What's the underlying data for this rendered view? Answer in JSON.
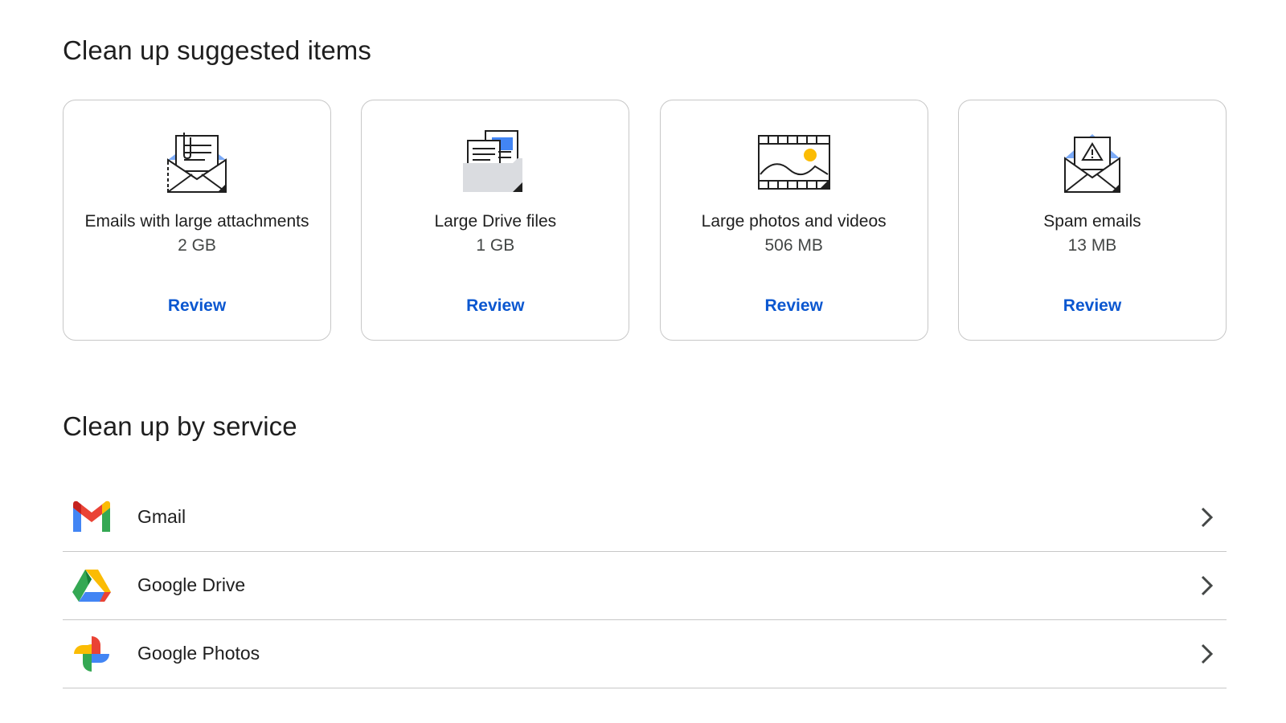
{
  "suggested": {
    "title": "Clean up suggested items",
    "cards": [
      {
        "icon": "email-attachment-icon",
        "label": "Emails with large attachments",
        "size": "2 GB",
        "action": "Review"
      },
      {
        "icon": "drive-files-icon",
        "label": "Large Drive files",
        "size": "1 GB",
        "action": "Review"
      },
      {
        "icon": "photos-videos-icon",
        "label": "Large photos and videos",
        "size": "506 MB",
        "action": "Review"
      },
      {
        "icon": "spam-email-icon",
        "label": "Spam emails",
        "size": "13 MB",
        "action": "Review"
      }
    ]
  },
  "by_service": {
    "title": "Clean up by service",
    "items": [
      {
        "icon": "gmail-logo-icon",
        "label": "Gmail"
      },
      {
        "icon": "google-drive-logo-icon",
        "label": "Google Drive"
      },
      {
        "icon": "google-photos-logo-icon",
        "label": "Google Photos"
      }
    ]
  },
  "colors": {
    "link": "#0b57d0",
    "border": "#c7c7c7",
    "google_blue": "#4285f4",
    "google_red": "#ea4335",
    "google_yellow": "#fbbc04",
    "google_green": "#34a853"
  }
}
